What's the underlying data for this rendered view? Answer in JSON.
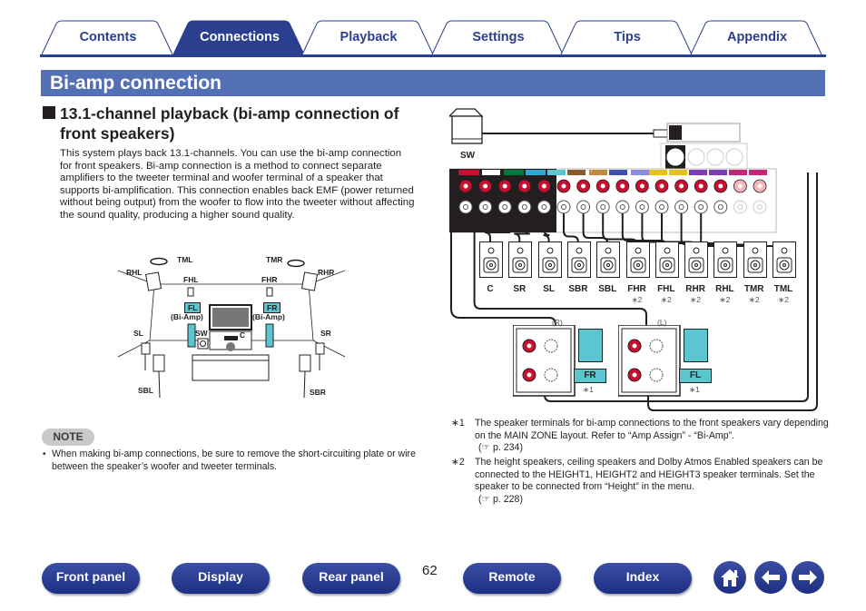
{
  "tabs": [
    {
      "label": "Contents",
      "active": false
    },
    {
      "label": "Connections",
      "active": true
    },
    {
      "label": "Playback",
      "active": false
    },
    {
      "label": "Settings",
      "active": false
    },
    {
      "label": "Tips",
      "active": false
    },
    {
      "label": "Appendix",
      "active": false
    }
  ],
  "colors": {
    "accent": "#2b3f8f",
    "title_bar": "#5470b4",
    "speaker_teal": "#5bc6cf",
    "terminal_red": "#c8102e"
  },
  "page": {
    "title": "Bi-amp connection",
    "section_heading": "13.1-channel playback (bi-amp connection of front speakers)",
    "body": "This system plays back 13.1-channels. You can use the bi-amp connection for front speakers. Bi-amp connection is a method to connect separate amplifiers to the tweeter terminal and woofer terminal of a speaker that supports bi-amplification. This connection enables back EMF (power returned without being output) from the woofer to flow into the tweeter without affecting the sound quality, producing a higher sound quality."
  },
  "room_diagram": {
    "labels": {
      "tml": "TML",
      "tmr": "TMR",
      "rhl": "RHL",
      "rhr": "RHR",
      "fhl": "FHL",
      "fhr": "FHR",
      "fl": "FL",
      "fr": "FR",
      "bi_amp_l": "(Bi-Amp)",
      "bi_amp_r": "(Bi-Amp)",
      "sl": "SL",
      "sr": "SR",
      "sw": "SW",
      "c": "C",
      "sbl": "SBL",
      "sbr": "SBR"
    }
  },
  "note": {
    "badge": "NOTE",
    "items": [
      "When making bi-amp connections, be sure to remove the short-circuiting plate or wire between the speaker’s woofer and tweeter terminals."
    ]
  },
  "wiring_diagram": {
    "subwoofer_label": "SW",
    "speakers": [
      {
        "label": "C",
        "note": ""
      },
      {
        "label": "SR",
        "note": ""
      },
      {
        "label": "SL",
        "note": ""
      },
      {
        "label": "SBR",
        "note": ""
      },
      {
        "label": "SBL",
        "note": ""
      },
      {
        "label": "FHR",
        "note": "∗2"
      },
      {
        "label": "FHL",
        "note": "∗2"
      },
      {
        "label": "RHR",
        "note": "∗2"
      },
      {
        "label": "RHL",
        "note": "∗2"
      },
      {
        "label": "TMR",
        "note": "∗2"
      },
      {
        "label": "TML",
        "note": "∗2"
      }
    ],
    "front_right": {
      "channel": "(R)",
      "label": "FR",
      "note": "∗1"
    },
    "front_left": {
      "channel": "(L)",
      "label": "FL",
      "note": "∗1"
    }
  },
  "footnotes": [
    {
      "mark": "∗1",
      "text": "The speaker terminals for bi-amp connections to the front speakers vary depending on the MAIN ZONE layout. Refer to “Amp Assign” - “Bi-Amp”.",
      "ref": "p. 234"
    },
    {
      "mark": "∗2",
      "text": "The height speakers, ceiling speakers and Dolby Atmos Enabled speakers can be connected to the HEIGHT1, HEIGHT2 and HEIGHT3 speaker terminals. Set the speaker to be connected from “Height” in the menu.",
      "ref": "p. 228"
    }
  ],
  "bottom_nav": {
    "front_panel": "Front panel",
    "display": "Display",
    "rear_panel": "Rear panel",
    "page_number": "62",
    "remote": "Remote",
    "index": "Index",
    "home_icon": "home-icon",
    "back_icon": "arrow-left-icon",
    "forward_icon": "arrow-right-icon"
  }
}
